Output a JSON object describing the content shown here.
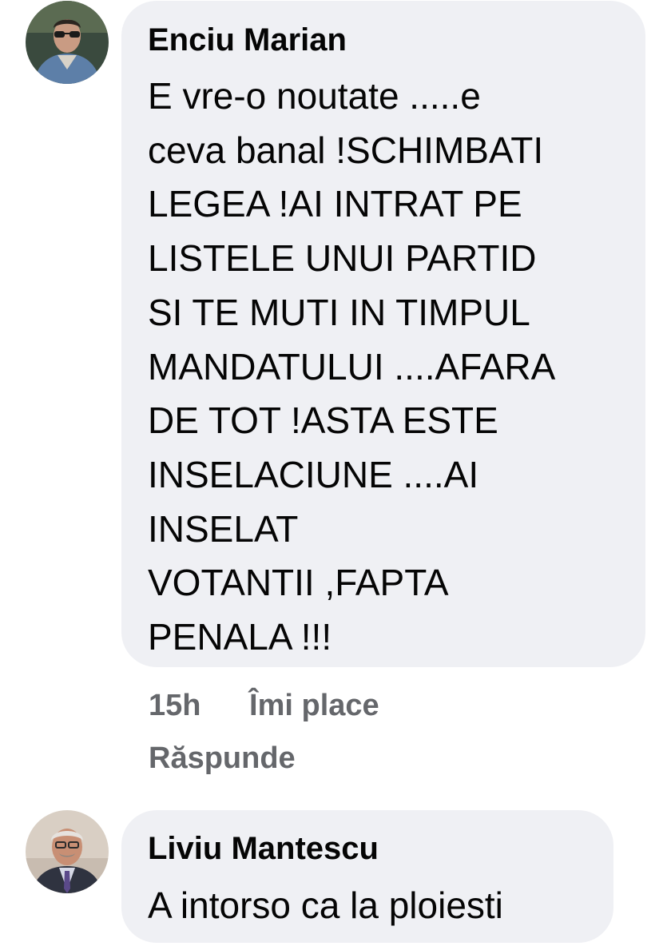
{
  "comments": [
    {
      "author": "Enciu Marian",
      "text_lines": [
        "E vre-o noutate .....e",
        "ceva banal !SCHIMBATI",
        "LEGEA !AI INTRAT PE",
        "LISTELE UNUI PARTID",
        "SI TE MUTI IN TIMPUL",
        "MANDATULUI ....AFARA",
        "DE TOT !ASTA ESTE",
        "INSELACIUNE ....AI",
        "INSELAT",
        "VOTANTII ,FAPTA",
        "PENALA !!!"
      ],
      "time": "15h",
      "like_label": "Îmi place",
      "reply_label": "Răspunde"
    },
    {
      "author": "Liviu Mantescu",
      "text_lines": [
        "A intorso ca la ploiesti"
      ]
    }
  ],
  "colors": {
    "bubble": "#eff0f4",
    "text": "#050505",
    "meta": "#65676b"
  }
}
